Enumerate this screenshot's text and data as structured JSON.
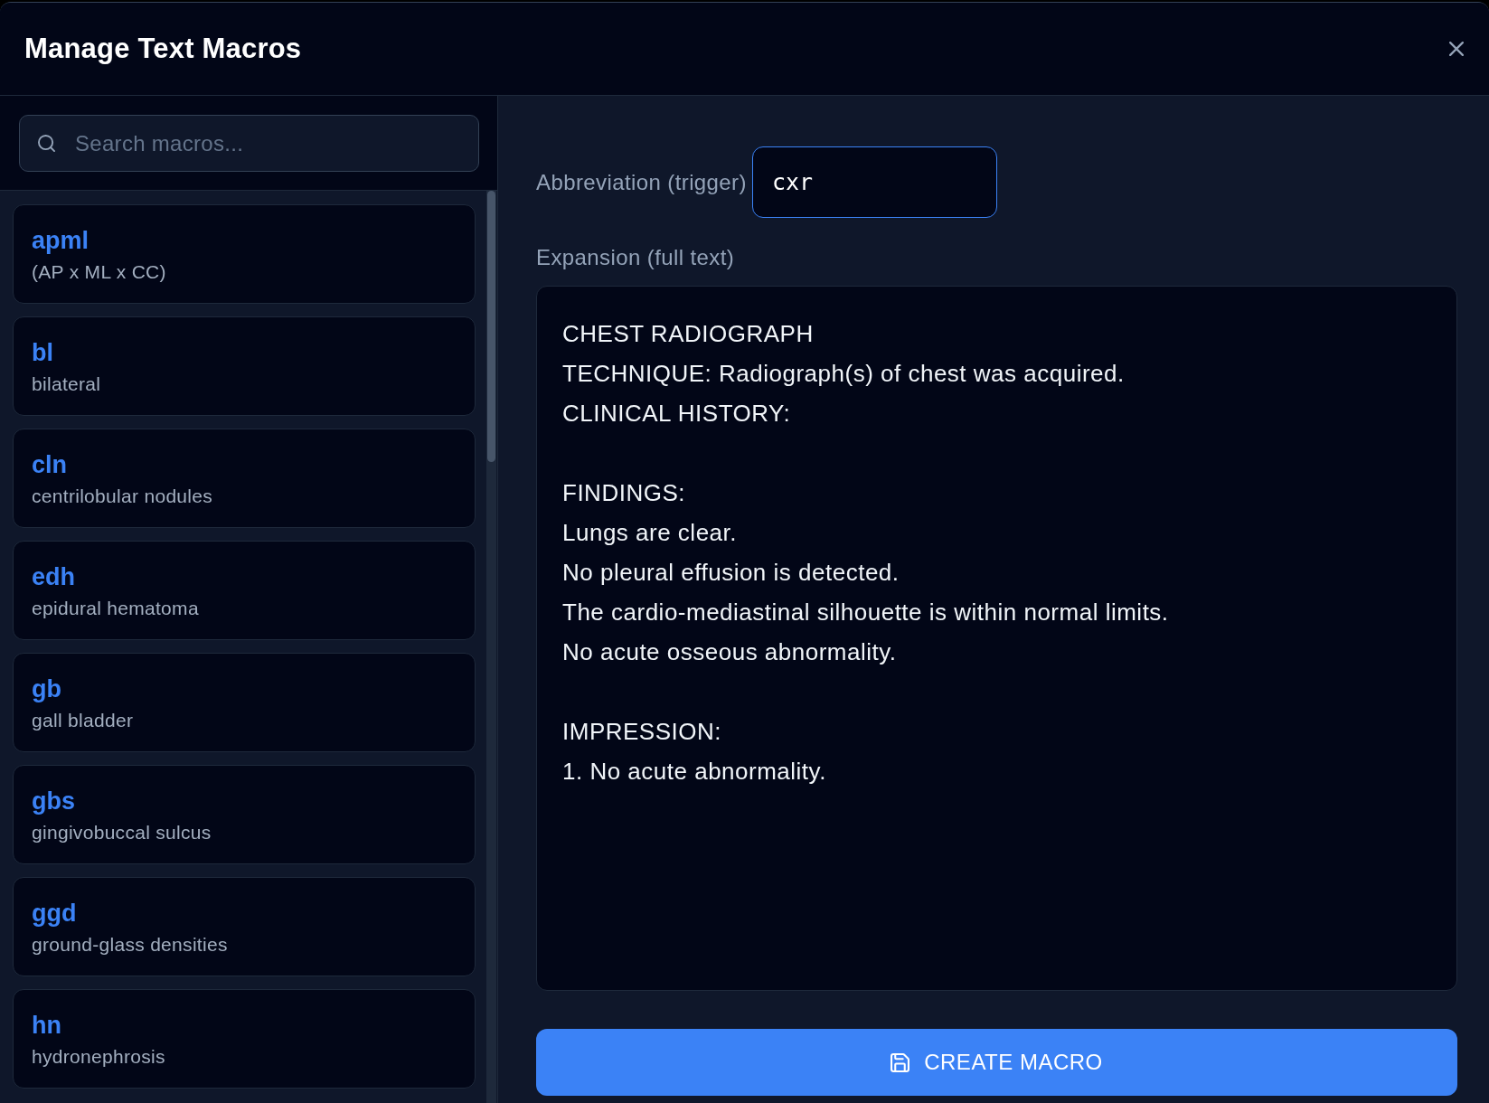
{
  "dialog": {
    "title": "Manage Text Macros"
  },
  "search": {
    "placeholder": "Search macros..."
  },
  "macros": [
    {
      "abbreviation": "apml",
      "expansion": "(AP x ML x CC)"
    },
    {
      "abbreviation": "bl",
      "expansion": "bilateral"
    },
    {
      "abbreviation": "cln",
      "expansion": "centrilobular nodules"
    },
    {
      "abbreviation": "edh",
      "expansion": "epidural hematoma"
    },
    {
      "abbreviation": "gb",
      "expansion": "gall bladder"
    },
    {
      "abbreviation": "gbs",
      "expansion": "gingivobuccal sulcus"
    },
    {
      "abbreviation": "ggd",
      "expansion": "ground-glass densities"
    },
    {
      "abbreviation": "hn",
      "expansion": "hydronephrosis"
    }
  ],
  "editor": {
    "abbreviation": {
      "label": "Abbreviation (trigger)",
      "value": "cxr",
      "focused": true
    },
    "expansion": {
      "label": "Expansion (full text)",
      "value": "CHEST RADIOGRAPH\nTECHNIQUE: Radiograph(s) of chest was acquired.\nCLINICAL HISTORY:\n\nFINDINGS:\nLungs are clear.\nNo pleural effusion is detected.\nThe cardio-mediastinal silhouette is within normal limits.\nNo acute osseous abnormality.\n\nIMPRESSION:\n1. No acute abnormality."
    }
  },
  "create_button": {
    "label": "CREATE MACRO"
  }
}
